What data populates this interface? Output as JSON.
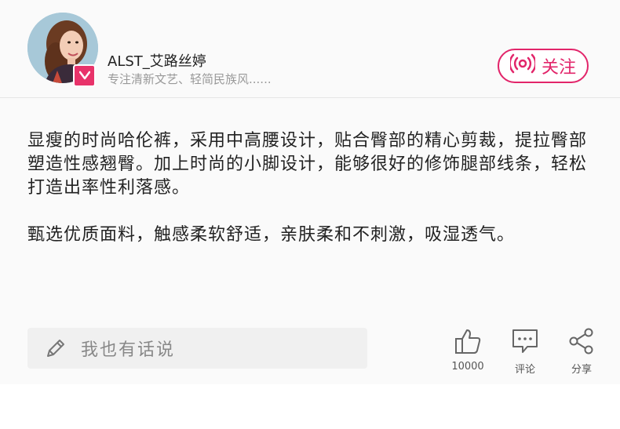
{
  "author": {
    "name": "ALST_艾路丝婷",
    "bio": "专注清新文艺、轻简民族风......",
    "verified_icon": "v-badge-icon"
  },
  "follow": {
    "label": "关注",
    "icon": "broadcast-icon",
    "color": "#e2256a"
  },
  "post": {
    "paragraphs": [
      "显瘦的时尚哈伦裤，采用中高腰设计，贴合臀部的精心剪裁，提拉臀部塑造性感翘臀。加上时尚的小脚设计，能够很好的修饰腿部线条，轻松打造出率性利落感。",
      "甄选优质面料，触感柔软舒适，亲肤柔和不刺激，吸湿透气。"
    ]
  },
  "footer": {
    "comment_placeholder": "我也有话说",
    "like": {
      "count": "10000",
      "icon": "thumbs-up-icon"
    },
    "comment": {
      "label": "评论",
      "icon": "speech-bubble-icon"
    },
    "share": {
      "label": "分享",
      "icon": "share-icon"
    }
  }
}
